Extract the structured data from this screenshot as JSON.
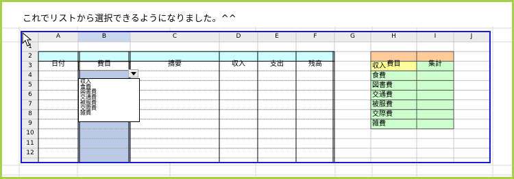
{
  "headline": "これでリストから選択できるようになりました。^^",
  "columns": [
    "A",
    "B",
    "C",
    "D",
    "E",
    "F",
    "G",
    "H",
    "I",
    "J"
  ],
  "rows": [
    "1",
    "2",
    "3",
    "4",
    "5",
    "6",
    "7",
    "8",
    "9",
    "10",
    "11",
    "12"
  ],
  "table_headers": {
    "date": "日付",
    "category": "費目",
    "summary": "摘要",
    "income": "収入",
    "expense": "支出",
    "balance": "残高"
  },
  "summary_table": {
    "header_category": "費目",
    "header_total": "集計",
    "categories": [
      "収入",
      "食費",
      "図書費",
      "交通費",
      "被服費",
      "交際費",
      "雑費"
    ]
  },
  "dropdown": {
    "options": [
      "収入",
      "食費",
      "図書費",
      "交通費",
      "被服費",
      "交際費",
      "雑費"
    ]
  },
  "colors": {
    "frame": "#a6d04a",
    "sheet_border": "#1a1ad0",
    "header_fill": "#ccffff",
    "selected_col": "#b9c9e6",
    "summary_header": "#ffcc99",
    "summary_income": "#ffff99",
    "summary_row": "#ccffcc"
  }
}
